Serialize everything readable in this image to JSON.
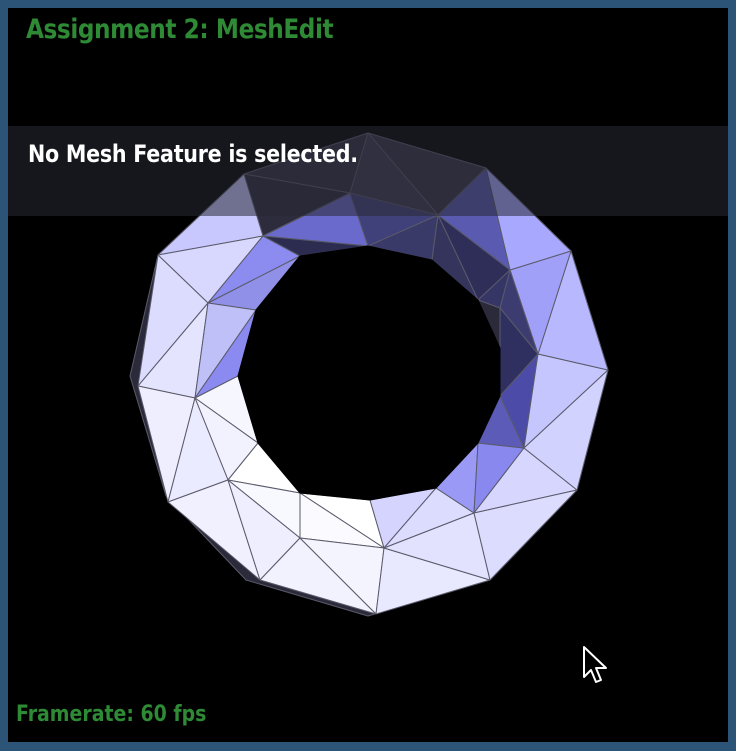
{
  "window": {
    "title": "Assignment 2: MeshEdit",
    "frame_color": "#2b5477",
    "background_color": "#000000"
  },
  "selection_info": {
    "message": "No Mesh Feature is selected."
  },
  "status": {
    "framerate_label": "Framerate: 60 fps"
  },
  "colors": {
    "title_color": "#2e8a35",
    "overlay_text_color": "#ffffff",
    "mesh_face_light": "#f4f4ff",
    "mesh_face_mid": "#b4b4ff",
    "mesh_face_dark": "#6a6ac8",
    "mesh_edge": "#555566"
  },
  "icons": {
    "cursor": "arrow-cursor-icon"
  }
}
